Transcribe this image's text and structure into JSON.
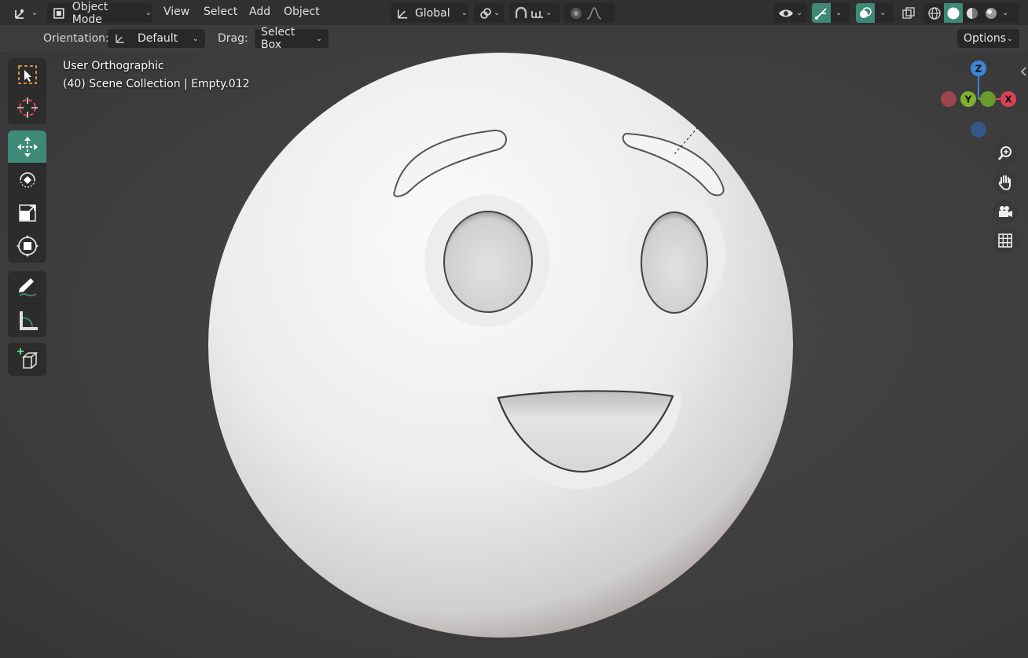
{
  "header": {
    "editor_type_icon": "axes-icon",
    "mode_label": "Object Mode",
    "menus": [
      "View",
      "Select",
      "Add",
      "Object"
    ],
    "orientation_label": "Global",
    "options_label": "Options"
  },
  "tool_settings": {
    "orientation_label": "Orientation:",
    "orientation_value": "Default",
    "drag_label": "Drag:",
    "drag_value": "Select Box"
  },
  "viewport": {
    "view_name": "User Orthographic",
    "collection_info": "(40) Scene Collection | Empty.012"
  },
  "gizmo": {
    "z": "Z",
    "y": "Y",
    "x": "X"
  },
  "tools": [
    {
      "name": "select-box-tool",
      "icon": "select-box-icon"
    },
    {
      "name": "cursor-tool",
      "icon": "cursor-icon"
    },
    {
      "name": "move-tool",
      "icon": "move-icon",
      "active": true
    },
    {
      "name": "rotate-tool",
      "icon": "rotate-icon"
    },
    {
      "name": "scale-tool",
      "icon": "scale-icon"
    },
    {
      "name": "transform-tool",
      "icon": "transform-icon"
    },
    {
      "name": "annotate-tool",
      "icon": "annotate-icon"
    },
    {
      "name": "measure-tool",
      "icon": "measure-icon"
    },
    {
      "name": "add-cube-tool",
      "icon": "add-cube-icon"
    }
  ],
  "colors": {
    "accent": "#3e8a77",
    "axis_x": "#d9435a",
    "axis_y": "#7fb030",
    "axis_z": "#3f86d6"
  }
}
